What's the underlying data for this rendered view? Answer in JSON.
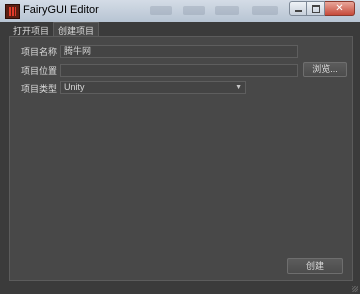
{
  "window": {
    "title": "FairyGUI Editor"
  },
  "tabs": [
    {
      "label": "打开项目",
      "active": false
    },
    {
      "label": "创建项目",
      "active": true
    }
  ],
  "form": {
    "name_label": "项目名称",
    "name_value": "腾牛网",
    "location_label": "项目位置",
    "location_value": "",
    "browse_label": "浏览...",
    "type_label": "项目类型",
    "type_value": "Unity"
  },
  "create_button": "创建",
  "colors": {
    "background": "#3b3b3b",
    "panel": "#484848",
    "text": "#dcdcdc"
  }
}
